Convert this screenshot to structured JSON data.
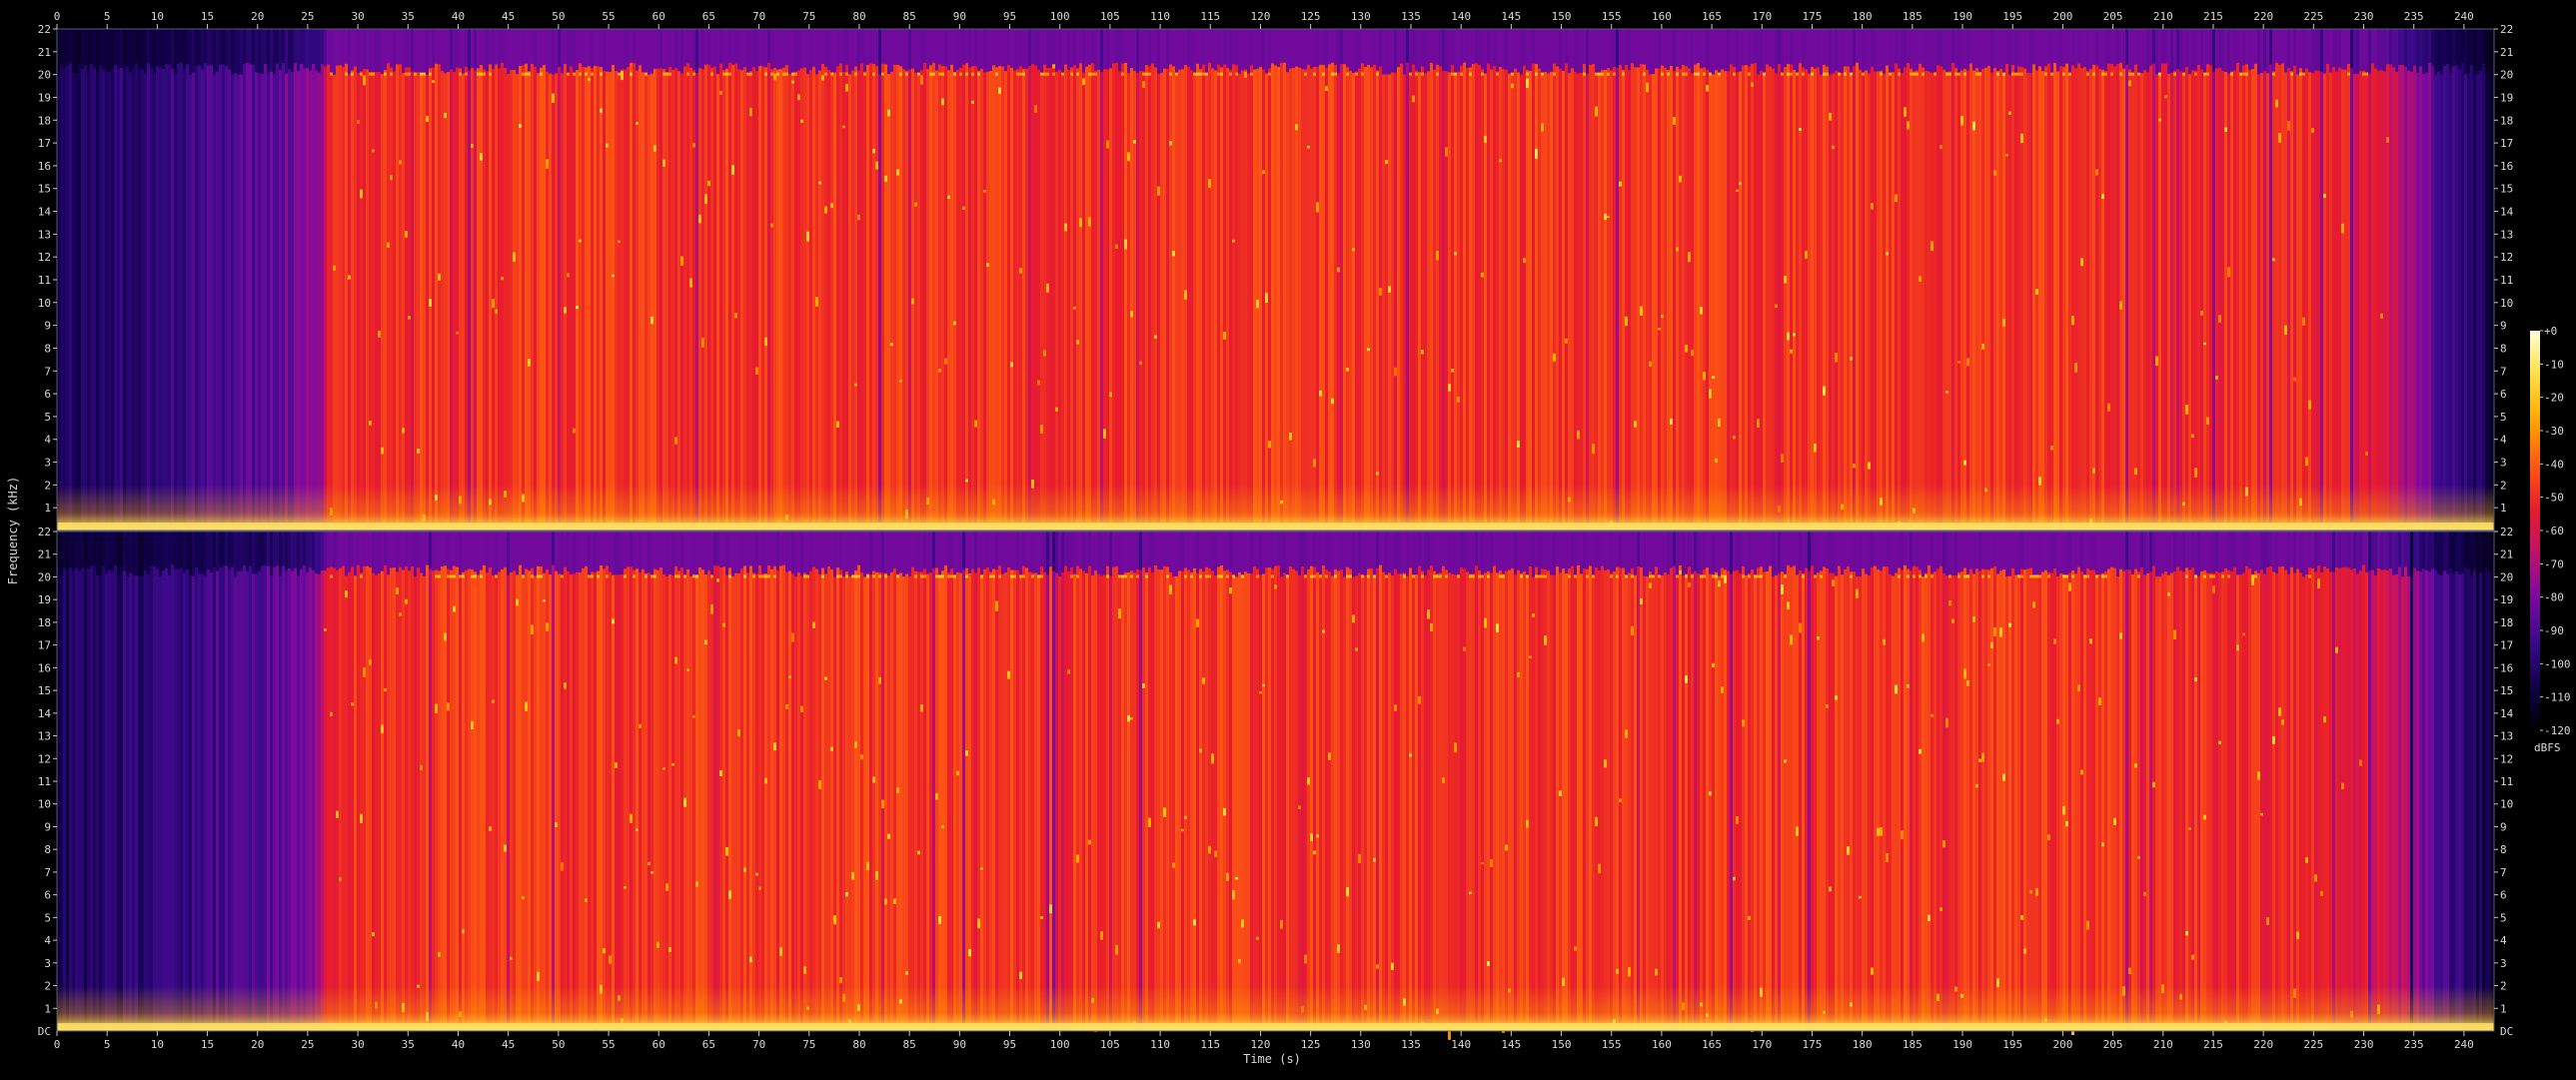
{
  "chart_data": {
    "type": "heatmap",
    "subtype": "spectrogram",
    "channels": 2,
    "xlabel": "Time (s)",
    "ylabel": "Frequency (kHz)",
    "colorbar_label": "dBFS",
    "xlim": [
      0,
      243
    ],
    "ylim_khz": [
      0,
      22
    ],
    "x_ticks": [
      0,
      5,
      10,
      15,
      20,
      25,
      30,
      35,
      40,
      45,
      50,
      55,
      60,
      65,
      70,
      75,
      80,
      85,
      90,
      95,
      100,
      105,
      110,
      115,
      120,
      125,
      130,
      135,
      140,
      145,
      150,
      155,
      160,
      165,
      170,
      175,
      180,
      185,
      190,
      195,
      200,
      205,
      210,
      215,
      220,
      225,
      230,
      235,
      240
    ],
    "y_tick_labels": [
      "1",
      "2",
      "3",
      "4",
      "5",
      "6",
      "7",
      "8",
      "9",
      "10",
      "11",
      "12",
      "13",
      "14",
      "15",
      "16",
      "17",
      "18",
      "19",
      "20",
      "21",
      "22"
    ],
    "dc_label": "DC",
    "colorbar_ticks": [
      "+0",
      "-10",
      "-20",
      "-30",
      "-40",
      "-50",
      "-60",
      "-70",
      "-80",
      "-90",
      "-100",
      "-110",
      "-120"
    ],
    "colorbar_range_db": [
      -120,
      0
    ],
    "colormap": [
      "#000000",
      "#10004a",
      "#3a0a8a",
      "#7a0aa0",
      "#c0106a",
      "#e81c2c",
      "#ff5a10",
      "#ffa800",
      "#ffe040",
      "#ffffd8"
    ],
    "intensity_profile": {
      "time_s": [
        0,
        5,
        15,
        22,
        26,
        27,
        28,
        200,
        215,
        225,
        232,
        236,
        240,
        243
      ],
      "level_db": [
        -105,
        -100,
        -92,
        -85,
        -74,
        -55,
        -48,
        -48,
        -50,
        -52,
        -60,
        -82,
        -100,
        -108
      ]
    },
    "bandwidth_cutoff_khz": 20,
    "grid": false
  }
}
